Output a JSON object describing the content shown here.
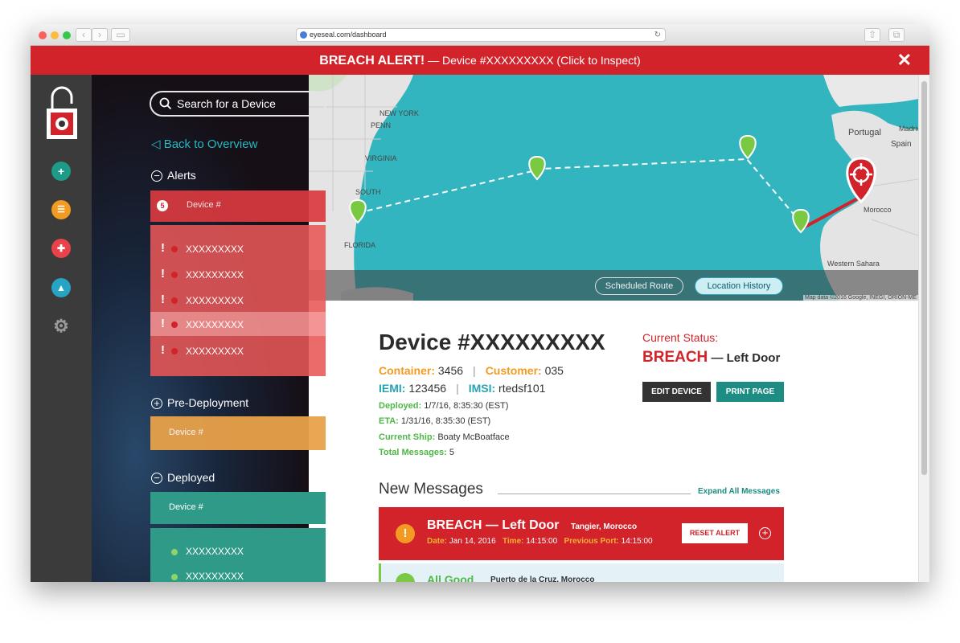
{
  "browser": {
    "url": "eyeseal.com/dashboard"
  },
  "banner": {
    "title": "BREACH ALERT!",
    "message": "— Device #XXXXXXXXX (Click to Inspect)",
    "close": "✕"
  },
  "rail": {
    "icons": [
      "lock-logo",
      "plus-icon",
      "list-icon",
      "puzzle-icon",
      "cone-icon",
      "gear-icon"
    ]
  },
  "sidebar": {
    "search_placeholder": "Search for a Device",
    "back": "Back to Overview",
    "alerts": {
      "heading": "Alerts",
      "toggle": "−",
      "count": "5",
      "column_label": "Device #",
      "items": [
        "XXXXXXXXX",
        "XXXXXXXXX",
        "XXXXXXXXX",
        "XXXXXXXXX",
        "XXXXXXXXX"
      ]
    },
    "pre_deployment": {
      "heading": "Pre-Deployment",
      "toggle": "+",
      "column_label": "Device #"
    },
    "deployed": {
      "heading": "Deployed",
      "toggle": "−",
      "column_label": "Device #",
      "items": [
        "XXXXXXXXX",
        "XXXXXXXXX"
      ]
    }
  },
  "map": {
    "labels": {
      "portugal": "Portugal",
      "madrid": "Madrid",
      "spain": "Spain",
      "morocco": "Morocco",
      "western_sahara": "Western Sahara",
      "florida": "FLORIDA",
      "south": "SOUTH",
      "new_york": "NEW YORK",
      "penn": "PENN",
      "virginia": "VIRGINIA"
    },
    "buttons": {
      "scheduled_route": "Scheduled Route",
      "location_history": "Location History"
    },
    "copyright": "Map data ©2016 Google, INEGI, ORION-ME",
    "zoom_in": "+",
    "zoom_out": "−"
  },
  "device": {
    "title": "Device #XXXXXXXXX",
    "container_label": "Container:",
    "container": "3456",
    "customer_label": "Customer:",
    "customer": "035",
    "iemi_label": "IEMI:",
    "iemi": "123456",
    "imsi_label": "IMSI:",
    "imsi": "rtedsf101",
    "deployed_label": "Deployed:",
    "deployed": "1/7/16, 8:35:30 (EST)",
    "eta_label": "ETA:",
    "eta": "1/31/16, 8:35:30 (EST)",
    "ship_label": "Current Ship:",
    "ship": "Boaty McBoatface",
    "messages_label": "Total Messages:",
    "messages": "5",
    "separator": "|"
  },
  "status": {
    "heading": "Current Status:",
    "value": "BREACH",
    "detail": "— Left Door",
    "edit": "EDIT DEVICE",
    "print": "PRINT PAGE"
  },
  "messages": {
    "title": "New Messages",
    "expand": "Expand All Messages",
    "breach": {
      "title": "BREACH — Left Door",
      "location": "Tangier, Morocco",
      "date_label": "Date:",
      "date": "Jan 14, 2016",
      "time_label": "Time:",
      "time": "14:15:00",
      "port_label": "Previous Port:",
      "port": "14:15:00",
      "reset": "RESET ALERT",
      "warn": "!",
      "plus": "+"
    },
    "good": {
      "title": "All Good",
      "location": "Puerto de la Cruz, Morocco"
    }
  },
  "colors": {
    "brand_red": "#d2232a",
    "teal": "#1d8c83",
    "orange": "#f29b23",
    "green": "#4fb648",
    "ocean": "#33b5c0"
  }
}
